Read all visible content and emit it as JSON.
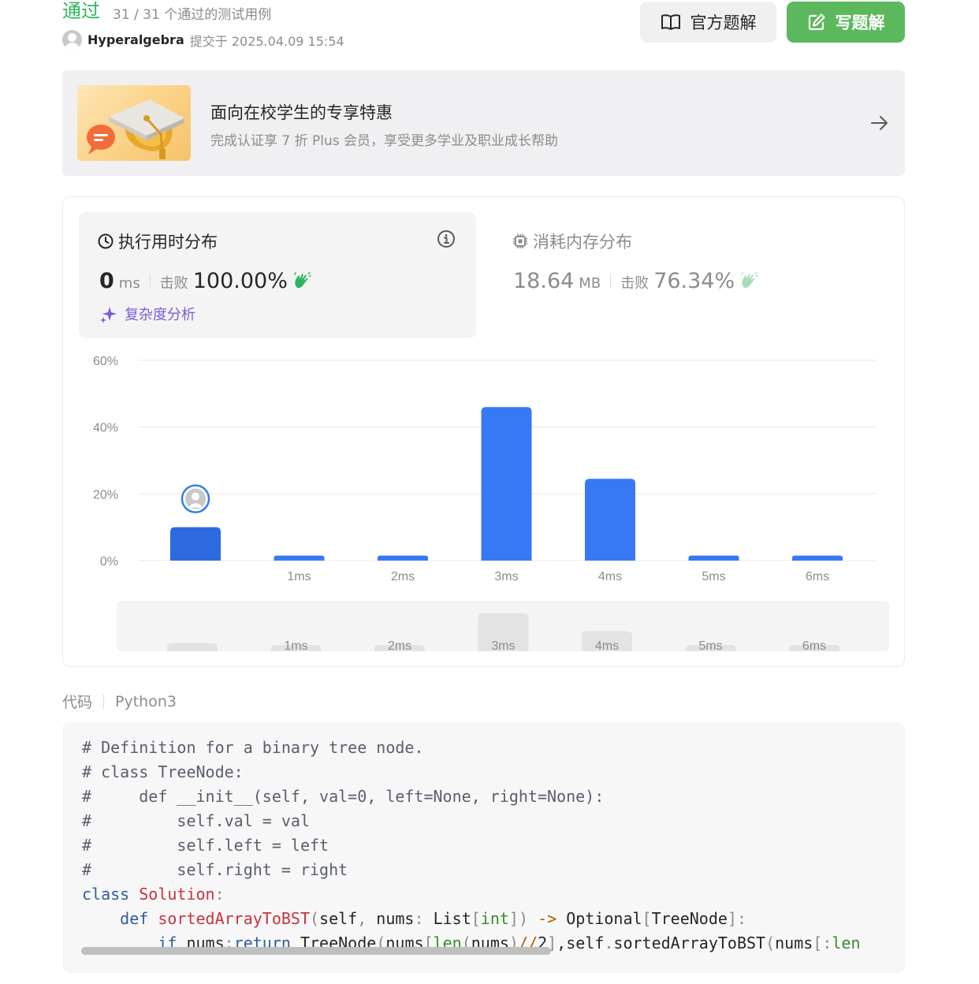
{
  "header": {
    "status": "通过",
    "test_count": "31 / 31 个通过的测试用例",
    "author": "Hyperalgebra",
    "submitted": "提交于 2025.04.09 15:54",
    "official_solution_label": "官方题解",
    "write_solution_label": "写题解"
  },
  "promo": {
    "title": "面向在校学生的专享特惠",
    "subtitle": "完成认证享 7 折 Plus 会员，享受更多学业及职业成长帮助"
  },
  "runtime": {
    "title": "执行用时分布",
    "value": "0",
    "unit": "ms",
    "beat_label": "击败",
    "beat_pct": "100.00%",
    "complexity_label": "复杂度分析"
  },
  "memory": {
    "title": "消耗内存分布",
    "value": "18.64",
    "unit": "MB",
    "beat_label": "击败",
    "beat_pct": "76.34%"
  },
  "chart_data": {
    "type": "bar",
    "categories": [
      "",
      "1ms",
      "2ms",
      "3ms",
      "4ms",
      "5ms",
      "6ms"
    ],
    "values": [
      10,
      1.5,
      1.5,
      46,
      24.5,
      1.5,
      1.5
    ],
    "y_ticks": [
      "0%",
      "20%",
      "40%",
      "60%"
    ],
    "ylim": [
      0,
      60
    ],
    "highlight_index": 0,
    "grid": true,
    "colors": {
      "bar": "#3779f5",
      "bar_highlight": "#2d6adf",
      "mini_bar": "#e3e3e3"
    }
  },
  "code": {
    "label": "代码",
    "language": "Python3"
  }
}
